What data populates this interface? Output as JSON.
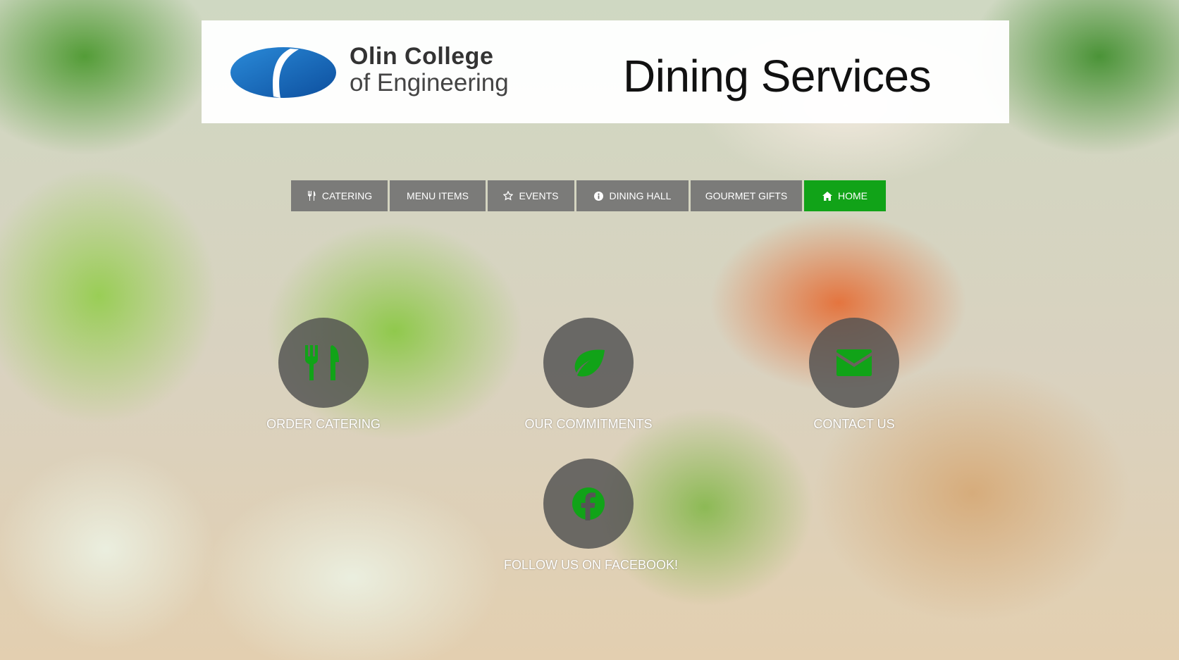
{
  "header": {
    "logo_line1": "Olin College",
    "logo_line2": "of Engineering",
    "site_title": "Dining Services"
  },
  "nav": {
    "items": [
      {
        "label": "CATERING",
        "icon": "utensils-icon"
      },
      {
        "label": "MENU ITEMS",
        "icon": ""
      },
      {
        "label": "EVENTS",
        "icon": "star-icon"
      },
      {
        "label": "DINING HALL",
        "icon": "info-icon"
      },
      {
        "label": "GOURMET GIFTS",
        "icon": ""
      },
      {
        "label": "HOME",
        "icon": "home-icon",
        "active": true
      }
    ]
  },
  "features": {
    "order_catering": {
      "label": "ORDER CATERING",
      "icon": "fork-knife-icon"
    },
    "our_commitments": {
      "label": "OUR COMMITMENTS",
      "icon": "leaf-icon"
    },
    "contact_us": {
      "label": "CONTACT US",
      "icon": "envelope-icon"
    },
    "facebook": {
      "label": "FOLLOW US ON FACEBOOK!",
      "icon": "facebook-icon"
    }
  },
  "colors": {
    "accent_green": "#11a318",
    "nav_gray": "#6e6e6e",
    "logo_blue": "#1a6fc0"
  }
}
